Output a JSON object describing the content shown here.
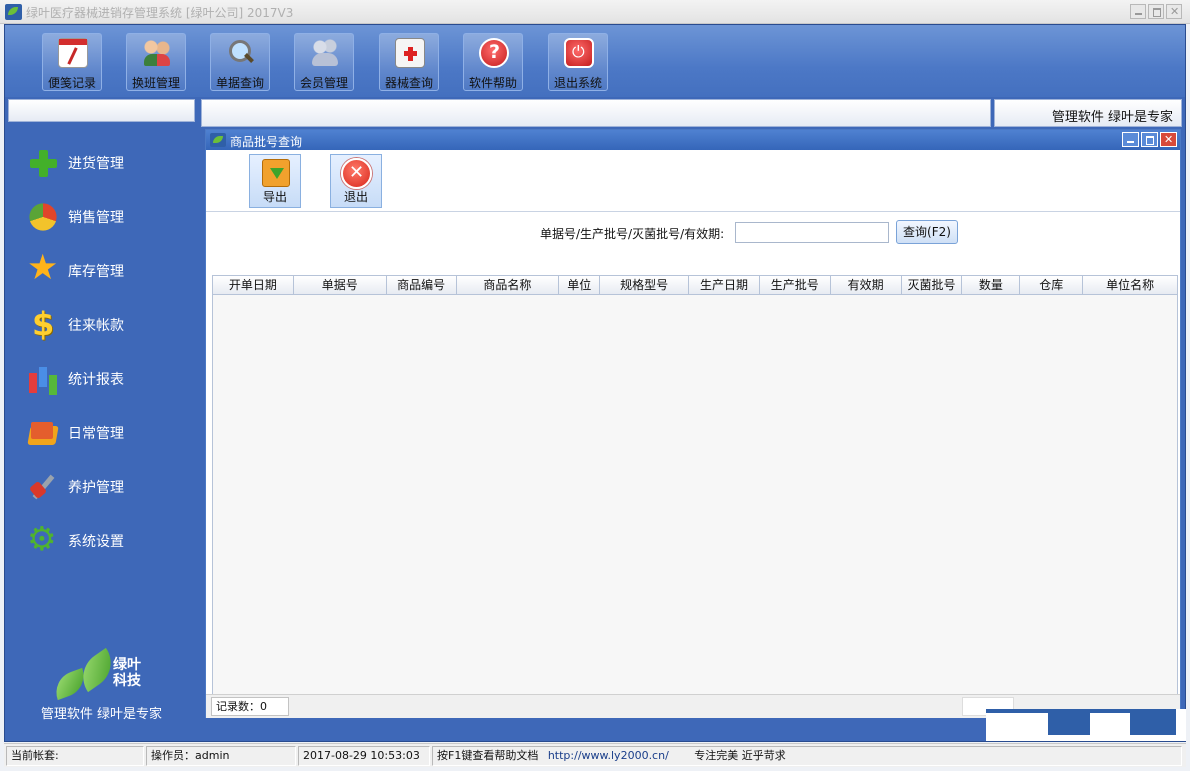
{
  "window": {
    "title": "绿叶医疗器械进销存管理系统 [绿叶公司] 2017V3"
  },
  "toolbar": {
    "buttons": [
      {
        "label": "便笺记录",
        "icon": "note-icon"
      },
      {
        "label": "换班管理",
        "icon": "shift-icon"
      },
      {
        "label": "单据查询",
        "icon": "search-icon"
      },
      {
        "label": "会员管理",
        "icon": "member-icon"
      },
      {
        "label": "器械查询",
        "icon": "device-icon"
      },
      {
        "label": "软件帮助",
        "icon": "help-icon"
      },
      {
        "label": "退出系统",
        "icon": "power-icon"
      }
    ]
  },
  "sidebar": {
    "items": [
      {
        "label": "进货管理",
        "icon": "plus-icon"
      },
      {
        "label": "销售管理",
        "icon": "pie-chart-icon"
      },
      {
        "label": "库存管理",
        "icon": "star-icon"
      },
      {
        "label": "往来帐款",
        "icon": "dollar-icon"
      },
      {
        "label": "统计报表",
        "icon": "bar-chart-icon"
      },
      {
        "label": "日常管理",
        "icon": "folder-icon"
      },
      {
        "label": "养护管理",
        "icon": "tools-icon"
      },
      {
        "label": "系统设置",
        "icon": "gear-icon"
      }
    ],
    "logo_text_1": "绿叶",
    "logo_text_2": "科技",
    "slogan": "管理软件 绿叶是专家"
  },
  "header": {
    "right_text": "管理软件 绿叶是专家"
  },
  "child_window": {
    "title": "商品批号查询",
    "export_label": "导出",
    "exit_label": "退出",
    "filter_label": "单据号/生产批号/灭菌批号/有效期:",
    "filter_value": "",
    "query_button": "查询(F2)",
    "columns": [
      "开单日期",
      "单据号",
      "商品编号",
      "商品名称",
      "单位",
      "规格型号",
      "生产日期",
      "生产批号",
      "有效期",
      "灭菌批号",
      "数量",
      "仓库",
      "单位名称"
    ],
    "record_count_label": "记录数：0"
  },
  "statusbar": {
    "account": "当前帐套:",
    "operator": "操作员：admin",
    "datetime": "2017-08-29 10:53:03",
    "help_text": "按F1键查看帮助文档",
    "url": "http://www.ly2000.cn/",
    "motto": "专注完美 近乎苛求"
  },
  "colors": {
    "frame_blue": "#3e68b8",
    "title_blue": "#3566b9",
    "accent_green": "#43b02a"
  }
}
